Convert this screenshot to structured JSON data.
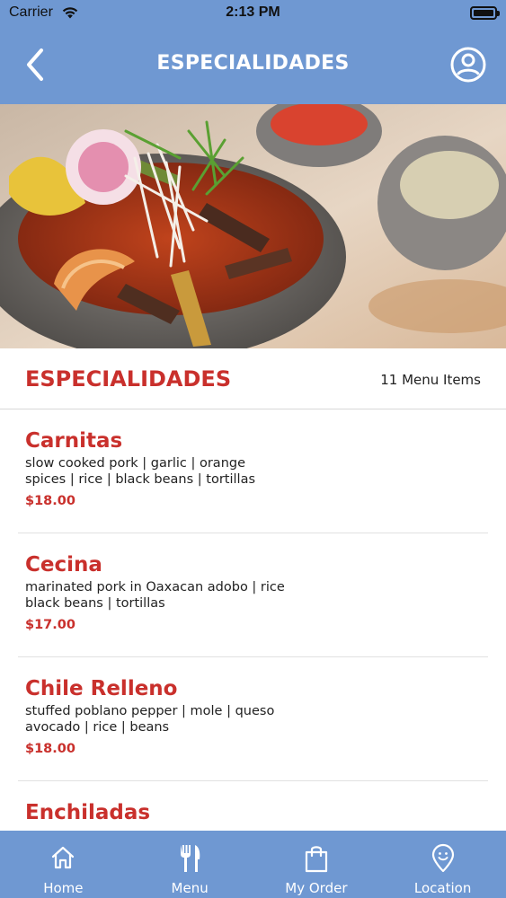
{
  "status_bar": {
    "carrier": "Carrier",
    "time": "2:13 PM"
  },
  "nav": {
    "title": "ESPECIALIDADES"
  },
  "section": {
    "title": "ESPECIALIDADES",
    "count": "11 Menu Items"
  },
  "menu_items": [
    {
      "name": "Carnitas",
      "desc_line1": "slow cooked pork | garlic | orange",
      "desc_line2": "spices | rice | black beans | tortillas",
      "price": "$18.00"
    },
    {
      "name": "Cecina",
      "desc_line1": "marinated pork in Oaxacan adobo | rice",
      "desc_line2": "black beans | tortillas",
      "price": "$17.00"
    },
    {
      "name": "Chile Relleno",
      "desc_line1": "stuffed poblano pepper | mole | queso",
      "desc_line2": "avocado | rice | beans",
      "price": "$18.00"
    },
    {
      "name": "Enchiladas",
      "desc_line1": "",
      "desc_line2": "",
      "price": ""
    }
  ],
  "tabs": [
    {
      "label": "Home",
      "icon": "home-icon"
    },
    {
      "label": "Menu",
      "icon": "fork-knife-icon"
    },
    {
      "label": "My Order",
      "icon": "shopping-bag-icon"
    },
    {
      "label": "Location",
      "icon": "location-pin-icon"
    }
  ],
  "colors": {
    "header_bg": "#6f98d2",
    "accent_red": "#c9302c"
  }
}
